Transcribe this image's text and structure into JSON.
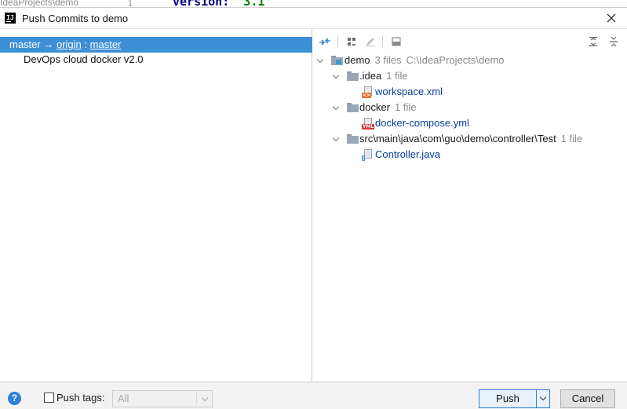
{
  "background": {
    "path_fragment": "IdeaProjects\\demo",
    "line_number": "1",
    "code_keyword": "version:",
    "code_string": "'3.1'"
  },
  "dialog": {
    "title": "Push Commits to demo"
  },
  "branch": {
    "local": "master",
    "arrow": "→",
    "remote": "origin",
    "separator": ":",
    "remote_branch": "master"
  },
  "commit": {
    "message": "DevOps cloud docker v2.0"
  },
  "toolbar": {
    "icons": [
      "show-diff-icon",
      "group-by-icon",
      "edit-source-icon",
      "collapse-panel-icon",
      "expand-all-icon",
      "collapse-all-icon"
    ]
  },
  "tree": {
    "root": {
      "name": "demo",
      "count": "3 files",
      "path": "C:\\IdeaProjects\\demo"
    },
    "groups": [
      {
        "name": ".idea",
        "count": "1 file",
        "file": "workspace.xml",
        "file_type": "xml"
      },
      {
        "name": "docker",
        "count": "1 file",
        "file": "docker-compose.yml",
        "file_type": "yml"
      },
      {
        "name": "src\\main\\java\\com\\guo\\demo\\controller\\Test",
        "count": "1 file",
        "file": "Controller.java",
        "file_type": "java"
      }
    ]
  },
  "footer": {
    "help": "?",
    "push_tags_label": "Push tags:",
    "push_tags_select": "All",
    "push_label": "Push",
    "cancel_label": "Cancel"
  },
  "colors": {
    "selection": "#3d8fd6",
    "file_link": "#0a3d9a",
    "accent": "#2f7fd2"
  }
}
